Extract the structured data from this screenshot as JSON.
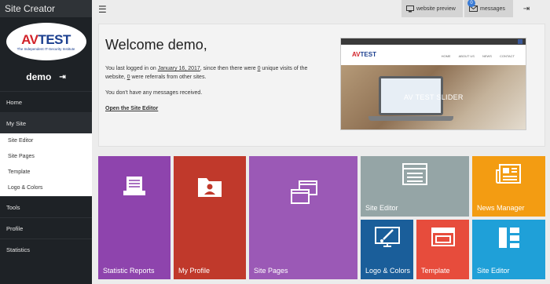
{
  "app": {
    "title": "Site Creator"
  },
  "sidebar": {
    "logo": {
      "mark_av": "AV",
      "mark_test": "TEST",
      "tagline": "The Independent IT-Security Institute"
    },
    "username": "demo",
    "nav_top": [
      {
        "label": "Home"
      },
      {
        "label": "My Site"
      }
    ],
    "subnav": [
      {
        "label": "Site Editor"
      },
      {
        "label": "Site Pages"
      },
      {
        "label": "Template"
      },
      {
        "label": "Logo & Colors"
      }
    ],
    "nav_bottom": [
      {
        "label": "Tools"
      },
      {
        "label": "Profile"
      },
      {
        "label": "Statistics"
      }
    ]
  },
  "topbar": {
    "menu_icon": "hamburger-icon",
    "preview_label": "website preview",
    "messages_label": "messages",
    "messages_count": "0"
  },
  "welcome": {
    "heading": "Welcome demo,",
    "line1_before": "You last logged in on ",
    "last_login_date": "January 16, 2017",
    "line1_mid": ", since then there were ",
    "unique_visits": "0",
    "line1_mid2": " unique visits of the website, ",
    "referrals": "0",
    "line1_end": " were referrals from other sites.",
    "messages_text": "You don't have any messages received.",
    "editor_link": "Open the Site Editor"
  },
  "preview": {
    "logo_av": "AV",
    "logo_test": "TEST",
    "nav": [
      "HOME",
      "ABOUT US",
      "NEWS",
      "CONTACT"
    ],
    "hero_text": "AV TEST SLIDER"
  },
  "tiles": [
    {
      "label": "Statistic Reports",
      "icon": "report-icon",
      "color": "#8e44ad"
    },
    {
      "label": "My Profile",
      "icon": "profile-folder-icon",
      "color": "#c0392b"
    },
    {
      "label": "Site Pages",
      "icon": "windows-icon",
      "color": "#9b59b6"
    },
    {
      "label": "Site Editor",
      "icon": "editor-window-icon",
      "color": "#95a5a6"
    },
    {
      "label": "News Manager",
      "icon": "newspaper-icon",
      "color": "#f39c12"
    },
    {
      "label": "Logo & Colors",
      "icon": "monitor-brush-icon",
      "color": "#1a5e9a"
    },
    {
      "label": "Template",
      "icon": "template-icon",
      "color": "#e74c3c"
    },
    {
      "label": "Site Editor",
      "icon": "layout-icon",
      "color": "#1fa0d8"
    }
  ]
}
